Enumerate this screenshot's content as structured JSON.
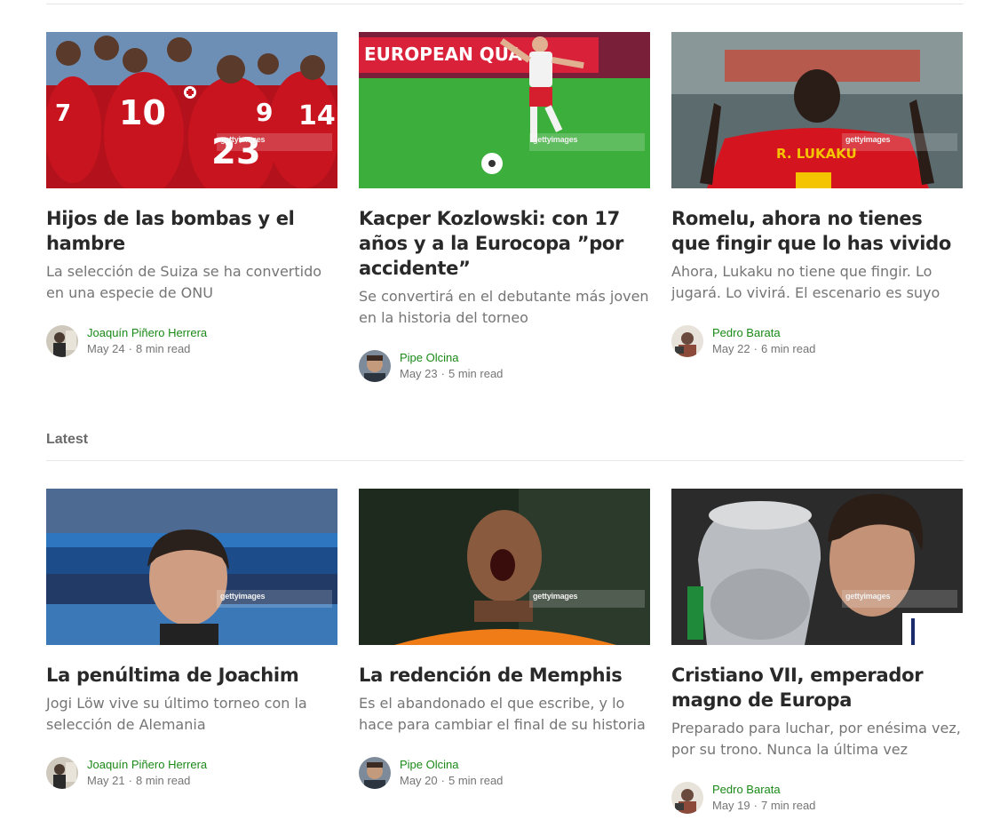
{
  "section": {
    "latest_label": "Latest"
  },
  "watermark": "gettyimages",
  "featured": [
    {
      "title": "Hijos de las bombas y el hambre",
      "subtitle": "La selección de Suiza se ha convertido en una especie de ONU",
      "author": "Joaquín Piñero Herrera",
      "date": "May 24",
      "read_time": "8 min read",
      "image": "swiss-team-celebration"
    },
    {
      "title": "Kacper Kozlowski: con 17 años y a la Eurocopa ”por accidente”",
      "subtitle": "Se convertirá en el debutante más joven en la historia del torneo",
      "author": "Pipe Olcina",
      "date": "May 23",
      "read_time": "5 min read",
      "image": "poland-player-kicking",
      "banner_text": "EUROPEAN QUA"
    },
    {
      "title": "Romelu, ahora no tienes que fingir que lo has vivido",
      "subtitle": "Ahora, Lukaku no tiene que fingir. Lo jugará. Lo vivirá. El escenario es suyo",
      "author": "Pedro Barata",
      "date": "May 22",
      "read_time": "6 min read",
      "image": "lukaku-back",
      "jersey_name": "R. LUKAKU"
    }
  ],
  "latest": [
    {
      "title": "La penúltima de Joachim",
      "subtitle": "Jogi Löw vive su último torneo con la selección de Alemania",
      "author": "Joaquín Piñero Herrera",
      "date": "May 21",
      "read_time": "8 min read",
      "image": "low-eyes-closed"
    },
    {
      "title": "La redención de Memphis",
      "subtitle": "Es el abandonado el que escribe, y lo hace para cambiar el final de su historia",
      "author": "Pipe Olcina",
      "date": "May 20",
      "read_time": "5 min read",
      "image": "memphis-shouting"
    },
    {
      "title": "Cristiano VII, emperador magno de Europa",
      "subtitle": "Preparado para luchar, por enésima vez, por su trono. Nunca la última vez",
      "author": "Pedro Barata",
      "date": "May 19",
      "read_time": "7 min read",
      "image": "ronaldo-trophy"
    }
  ],
  "colors": {
    "author_link": "#1a8917",
    "title": "#292929",
    "subtitle": "#757575"
  }
}
